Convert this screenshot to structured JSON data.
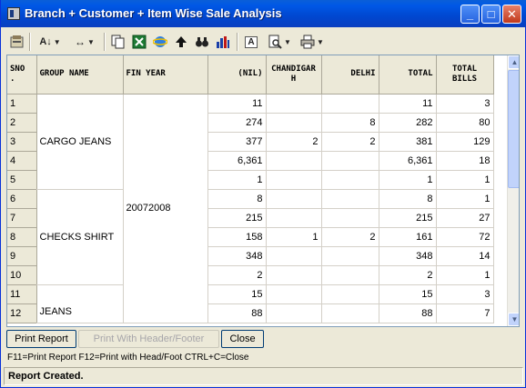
{
  "window": {
    "title": "Branch + Customer + Item Wise Sale Analysis"
  },
  "toolbar": {
    "tools": [
      "export-icon",
      "sort-icon",
      "column-width-icon",
      "copy-icon",
      "excel-icon",
      "browser-icon",
      "up-arrow-icon",
      "find-icon",
      "chart-icon",
      "font-icon",
      "print-preview-icon",
      "printer-icon"
    ]
  },
  "table": {
    "columns": [
      "SNO .",
      "GROUP NAME",
      "FIN YEAR",
      "(NIL)",
      "CHANDIGARH",
      "DELHI",
      "TOTAL",
      "TOTAL BILLS"
    ],
    "fin_year": "20072008",
    "groups": [
      {
        "name": "CARGO JEANS"
      },
      {
        "name": "CHECKS SHIRT"
      },
      {
        "name": "JEANS"
      }
    ],
    "rows": [
      {
        "sno": "1",
        "nil": "11",
        "chandigarh": "",
        "delhi": "",
        "total": "11",
        "bills": "3"
      },
      {
        "sno": "2",
        "nil": "274",
        "chandigarh": "",
        "delhi": "8",
        "total": "282",
        "bills": "80"
      },
      {
        "sno": "3",
        "nil": "377",
        "chandigarh": "2",
        "delhi": "2",
        "total": "381",
        "bills": "129"
      },
      {
        "sno": "4",
        "nil": "6,361",
        "chandigarh": "",
        "delhi": "",
        "total": "6,361",
        "bills": "18"
      },
      {
        "sno": "5",
        "nil": "1",
        "chandigarh": "",
        "delhi": "",
        "total": "1",
        "bills": "1"
      },
      {
        "sno": "6",
        "nil": "8",
        "chandigarh": "",
        "delhi": "",
        "total": "8",
        "bills": "1"
      },
      {
        "sno": "7",
        "nil": "215",
        "chandigarh": "",
        "delhi": "",
        "total": "215",
        "bills": "27"
      },
      {
        "sno": "8",
        "nil": "158",
        "chandigarh": "1",
        "delhi": "2",
        "total": "161",
        "bills": "72"
      },
      {
        "sno": "9",
        "nil": "348",
        "chandigarh": "",
        "delhi": "",
        "total": "348",
        "bills": "14"
      },
      {
        "sno": "10",
        "nil": "2",
        "chandigarh": "",
        "delhi": "",
        "total": "2",
        "bills": "1"
      },
      {
        "sno": "11",
        "nil": "15",
        "chandigarh": "",
        "delhi": "",
        "total": "15",
        "bills": "3"
      },
      {
        "sno": "12",
        "nil": "88",
        "chandigarh": "",
        "delhi": "",
        "total": "88",
        "bills": "7"
      }
    ]
  },
  "buttons": {
    "print_report": "Print Report",
    "print_header": "Print With Header/Footer",
    "close": "Close"
  },
  "hint": "F11=Print Report  F12=Print with Head/Foot  CTRL+C=Close",
  "status": "Report Created."
}
